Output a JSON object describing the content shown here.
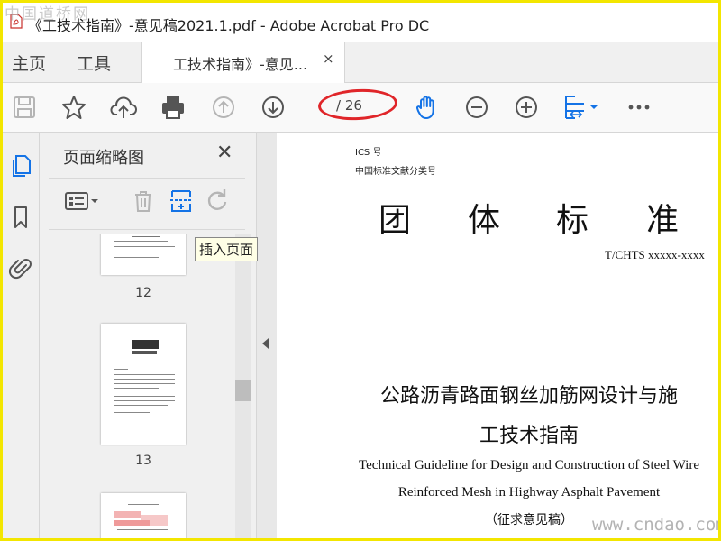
{
  "window": {
    "title": "《工技术指南》-意见稿2021.1.pdf - Adobe Acrobat Pro DC",
    "watermark_top": "中国道桥网"
  },
  "tabs": {
    "home": "主页",
    "tools": "工具",
    "document": "工技术指南》-意见...",
    "close_glyph": "×"
  },
  "toolbar": {
    "page_indicator": "/ 26",
    "icons": [
      "save-icon",
      "bookmark-star-icon",
      "cloud-upload-icon",
      "print-icon",
      "page-up-icon",
      "page-down-icon",
      "hand-tool-icon",
      "zoom-out-icon",
      "zoom-in-icon",
      "fit-width-icon",
      "more-icon"
    ]
  },
  "rail": {
    "icons": [
      "page-thumbnails-icon",
      "bookmarks-icon",
      "attachments-icon"
    ]
  },
  "thumbnail_panel": {
    "title": "页面缩略图",
    "close_glyph": "✕",
    "tooltip": "插入页面",
    "pages": [
      {
        "number": "12"
      },
      {
        "number": "13"
      }
    ]
  },
  "document": {
    "ics": "ICS 号",
    "clc": "中国标准文献分类号",
    "standard_title_chars": [
      "团",
      "体",
      "标",
      "准"
    ],
    "standard_code": "T/CHTS xxxxx-xxxx",
    "cn_title_line1": "公路沥青路面钢丝加筋网设计与施",
    "cn_title_line2": "工技术指南",
    "en_title_line1": "Technical Guideline for Design and Construction of Steel Wire",
    "en_title_line2": "Reinforced Mesh in Highway Asphalt Pavement",
    "draft_note": "（征求意见稿）",
    "watermark_bottom": "www.cndao.com"
  },
  "colors": {
    "accent_blue": "#1473e6",
    "annotation_red": "#e0262a",
    "frame_yellow": "#f3e600"
  }
}
